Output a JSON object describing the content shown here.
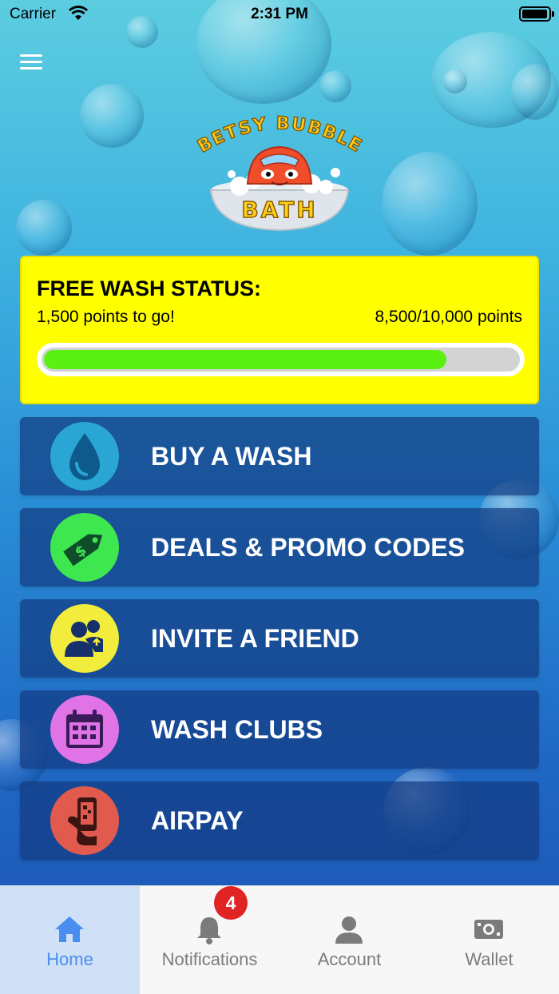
{
  "status_bar": {
    "carrier": "Carrier",
    "time": "2:31 PM"
  },
  "logo": {
    "line1": "BETSY BUBBLE",
    "line2": "BATH"
  },
  "wash_status": {
    "title": "FREE WASH STATUS:",
    "remaining": "1,500 points to go!",
    "progress_text": "8,500/10,000 points",
    "progress_fraction": 0.85
  },
  "menu": [
    {
      "label": "BUY A WASH",
      "icon": "water-drop-icon",
      "color": "#29a6d4"
    },
    {
      "label": "DEALS & PROMO CODES",
      "icon": "price-tag-icon",
      "color": "#3ee64f"
    },
    {
      "label": "INVITE A FRIEND",
      "icon": "invite-friend-icon",
      "color": "#f2ec3c"
    },
    {
      "label": "WASH CLUBS",
      "icon": "calendar-icon",
      "color": "#e074e6"
    },
    {
      "label": "AIRPAY",
      "icon": "phone-pay-icon",
      "color": "#e05a4e"
    }
  ],
  "tabs": [
    {
      "label": "Home",
      "icon": "home-icon",
      "active": true
    },
    {
      "label": "Notifications",
      "icon": "bell-icon",
      "badge": "4"
    },
    {
      "label": "Account",
      "icon": "person-icon"
    },
    {
      "label": "Wallet",
      "icon": "wallet-icon"
    }
  ],
  "colors": {
    "accent": "#4a8df0",
    "status_card": "#ffff00",
    "progress": "#5af011",
    "badge": "#e02323"
  }
}
